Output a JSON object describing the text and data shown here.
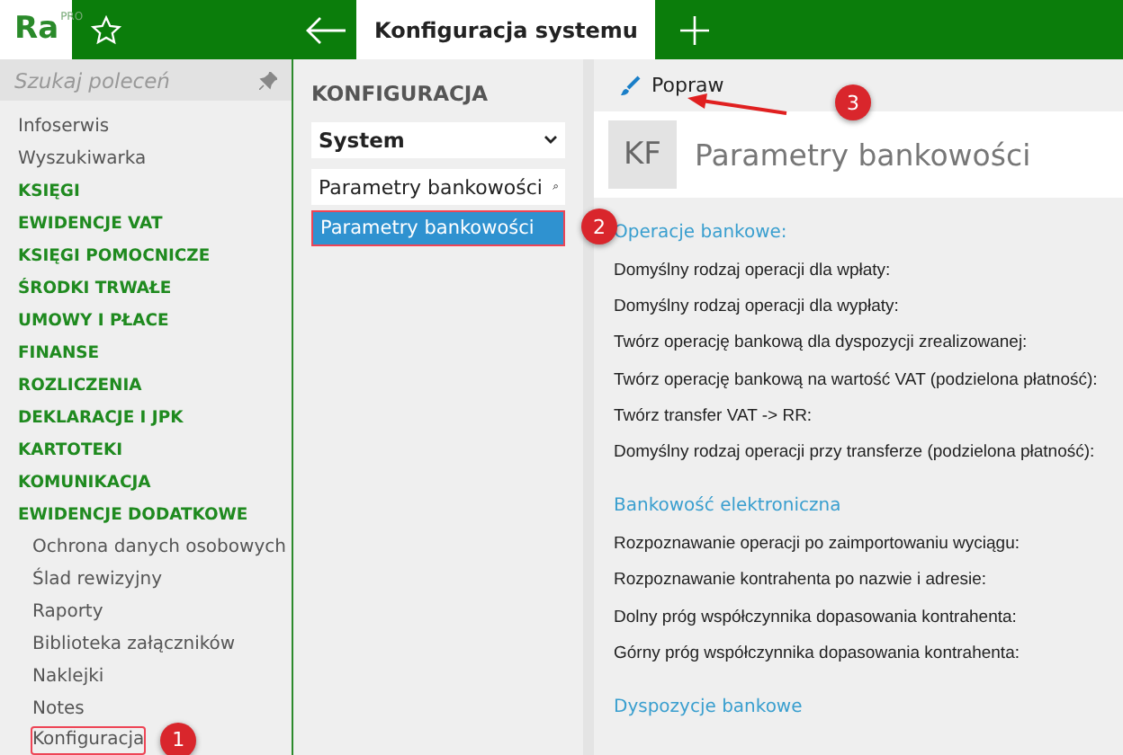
{
  "app": {
    "logo": "Ra",
    "edition": "PRO"
  },
  "tabs": [
    {
      "label": "Konfiguracja systemu",
      "selected": true
    }
  ],
  "sidebar": {
    "search": {
      "placeholder": "Szukaj poleceń"
    },
    "items": [
      {
        "label": "Infoserwis",
        "kind": "link"
      },
      {
        "label": "Wyszukiwarka",
        "kind": "link"
      },
      {
        "label": "KSIĘGI",
        "kind": "section"
      },
      {
        "label": "EWIDENCJE VAT",
        "kind": "section"
      },
      {
        "label": "KSIĘGI POMOCNICZE",
        "kind": "section"
      },
      {
        "label": "ŚRODKI TRWAŁE",
        "kind": "section"
      },
      {
        "label": "UMOWY I PŁACE",
        "kind": "section"
      },
      {
        "label": "FINANSE",
        "kind": "section"
      },
      {
        "label": "ROZLICZENIA",
        "kind": "section"
      },
      {
        "label": "DEKLARACJE I JPK",
        "kind": "section"
      },
      {
        "label": "KARTOTEKI",
        "kind": "section"
      },
      {
        "label": "KOMUNIKACJA",
        "kind": "section"
      },
      {
        "label": "EWIDENCJE DODATKOWE",
        "kind": "section"
      },
      {
        "label": "Ochrona danych osobowych",
        "kind": "subitem"
      },
      {
        "label": "Ślad rewizyjny",
        "kind": "subitem"
      },
      {
        "label": "Raporty",
        "kind": "subitem"
      },
      {
        "label": "Biblioteka załączników",
        "kind": "subitem"
      },
      {
        "label": "Naklejki",
        "kind": "subitem"
      },
      {
        "label": "Notes",
        "kind": "subitem"
      },
      {
        "label": "Konfiguracja",
        "kind": "subitem",
        "callout": "1"
      }
    ]
  },
  "config_panel": {
    "title": "KONFIGURACJA",
    "category": "System",
    "search": {
      "value": "Parametry bankowości"
    },
    "items": [
      {
        "label": "Parametry bankowości",
        "selected": true,
        "callout": "2"
      }
    ]
  },
  "toolbar": {
    "buttons": [
      {
        "label": "Popraw",
        "callout": "3"
      }
    ]
  },
  "header": {
    "badge": "KF",
    "title": "Parametry bankowości"
  },
  "sections": [
    {
      "title": "Operacje bankowe:",
      "fields": [
        "Domyślny rodzaj operacji dla wpłaty:",
        "Domyślny rodzaj operacji dla wypłaty:",
        "Twórz operację bankową dla dyspozycji zrealizowanej:",
        "Twórz operację bankową na wartość VAT (podzielona płatność):",
        "Twórz transfer VAT -> RR:",
        "Domyślny rodzaj operacji przy transferze (podzielona płatność):"
      ]
    },
    {
      "title": "Bankowość elektroniczna",
      "fields": [
        "Rozpoznawanie operacji po zaimportowaniu wyciągu:",
        "Rozpoznawanie kontrahenta po nazwie i adresie:",
        "Dolny próg współczynnika dopasowania kontrahenta:",
        "Górny próg współczynnika dopasowania kontrahenta:"
      ]
    },
    {
      "title": "Dyspozycje bankowe"
    }
  ]
}
